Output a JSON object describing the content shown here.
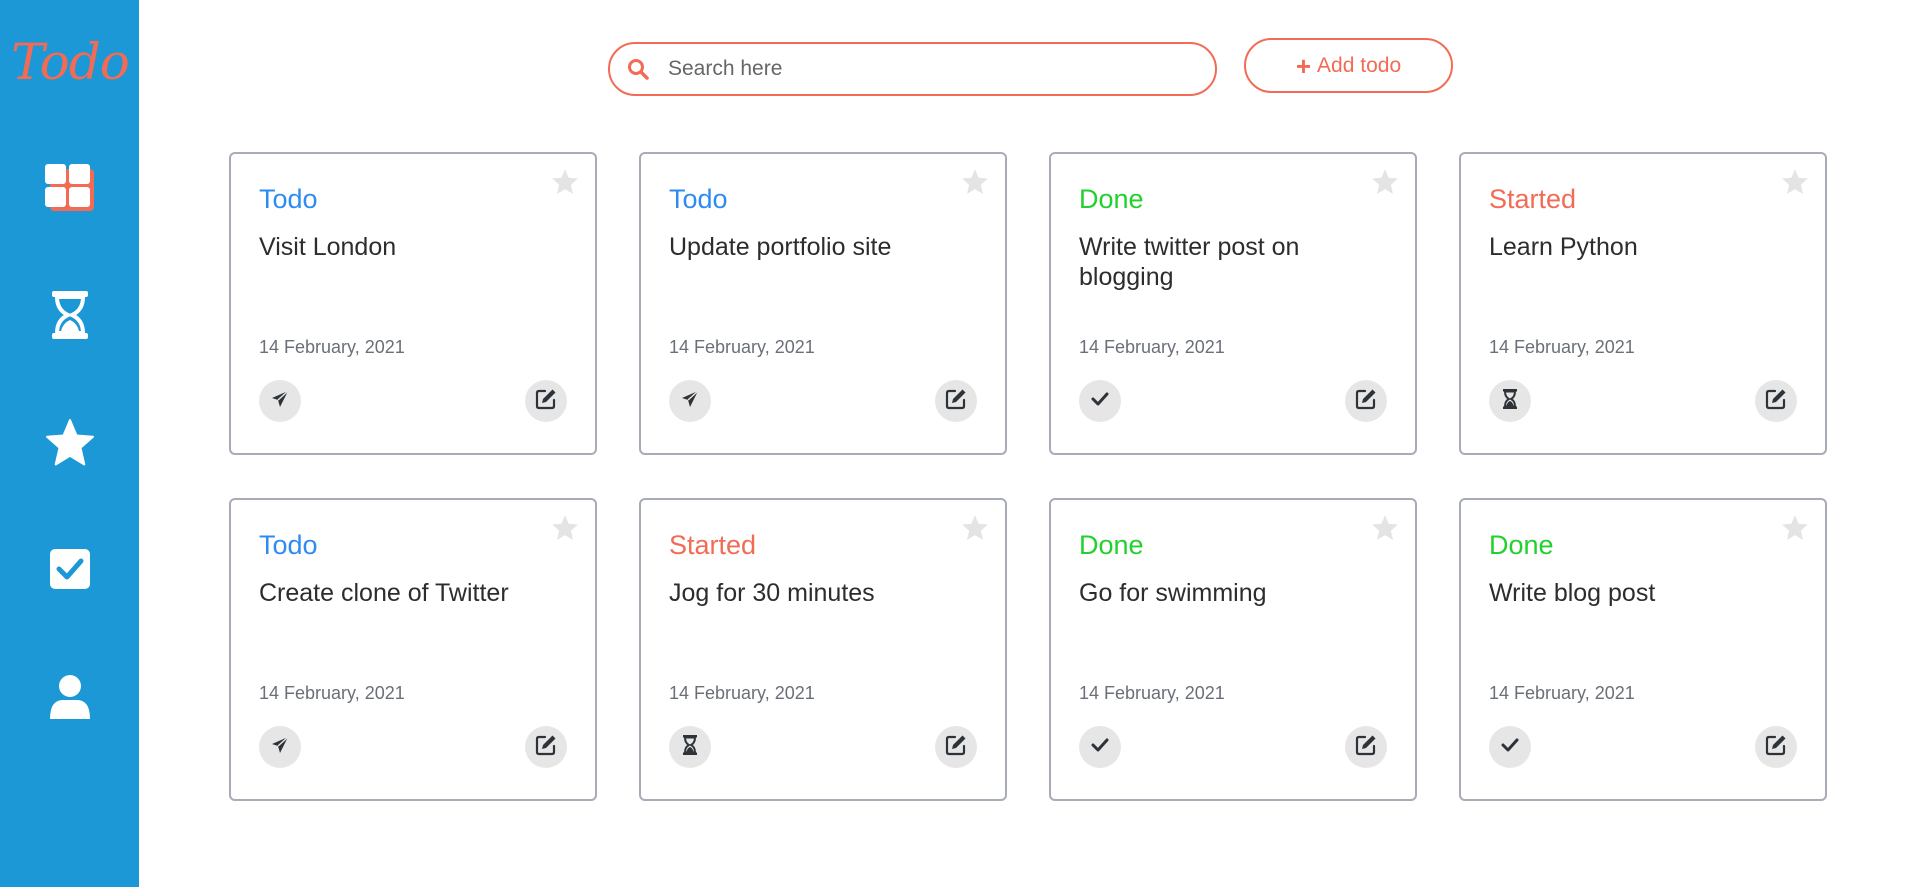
{
  "app": {
    "logo_text": "Todo"
  },
  "sidebar": {
    "items": [
      {
        "name": "dashboard-grid-icon"
      },
      {
        "name": "hourglass-icon"
      },
      {
        "name": "star-icon"
      },
      {
        "name": "checkbox-icon"
      },
      {
        "name": "user-icon"
      }
    ]
  },
  "search": {
    "placeholder": "Search here",
    "value": ""
  },
  "toolbar": {
    "add_label": "Add todo",
    "add_icon": "plus-icon"
  },
  "colors": {
    "accent": "#f26b55",
    "sidebar": "#1b98d5",
    "todo": "#2e8cf0",
    "done": "#22d12e",
    "started": "#f26b55"
  },
  "cards": [
    {
      "status": "Todo",
      "title": "Visit London",
      "date": "14 February, 2021",
      "action_icon": "send-icon"
    },
    {
      "status": "Todo",
      "title": "Update portfolio site",
      "date": "14 February, 2021",
      "action_icon": "send-icon"
    },
    {
      "status": "Done",
      "title": "Write twitter post on blogging",
      "date": "14 February, 2021",
      "action_icon": "check-icon"
    },
    {
      "status": "Started",
      "title": "Learn Python",
      "date": "14 February, 2021",
      "action_icon": "hourglass-icon"
    },
    {
      "status": "Todo",
      "title": "Create clone of Twitter",
      "date": "14 February, 2021",
      "action_icon": "send-icon"
    },
    {
      "status": "Started",
      "title": "Jog for 30 minutes",
      "date": "14 February, 2021",
      "action_icon": "hourglass-icon"
    },
    {
      "status": "Done",
      "title": "Go for swimming",
      "date": "14 February, 2021",
      "action_icon": "check-icon"
    },
    {
      "status": "Done",
      "title": "Write blog post",
      "date": "14 February, 2021",
      "action_icon": "check-icon"
    }
  ]
}
